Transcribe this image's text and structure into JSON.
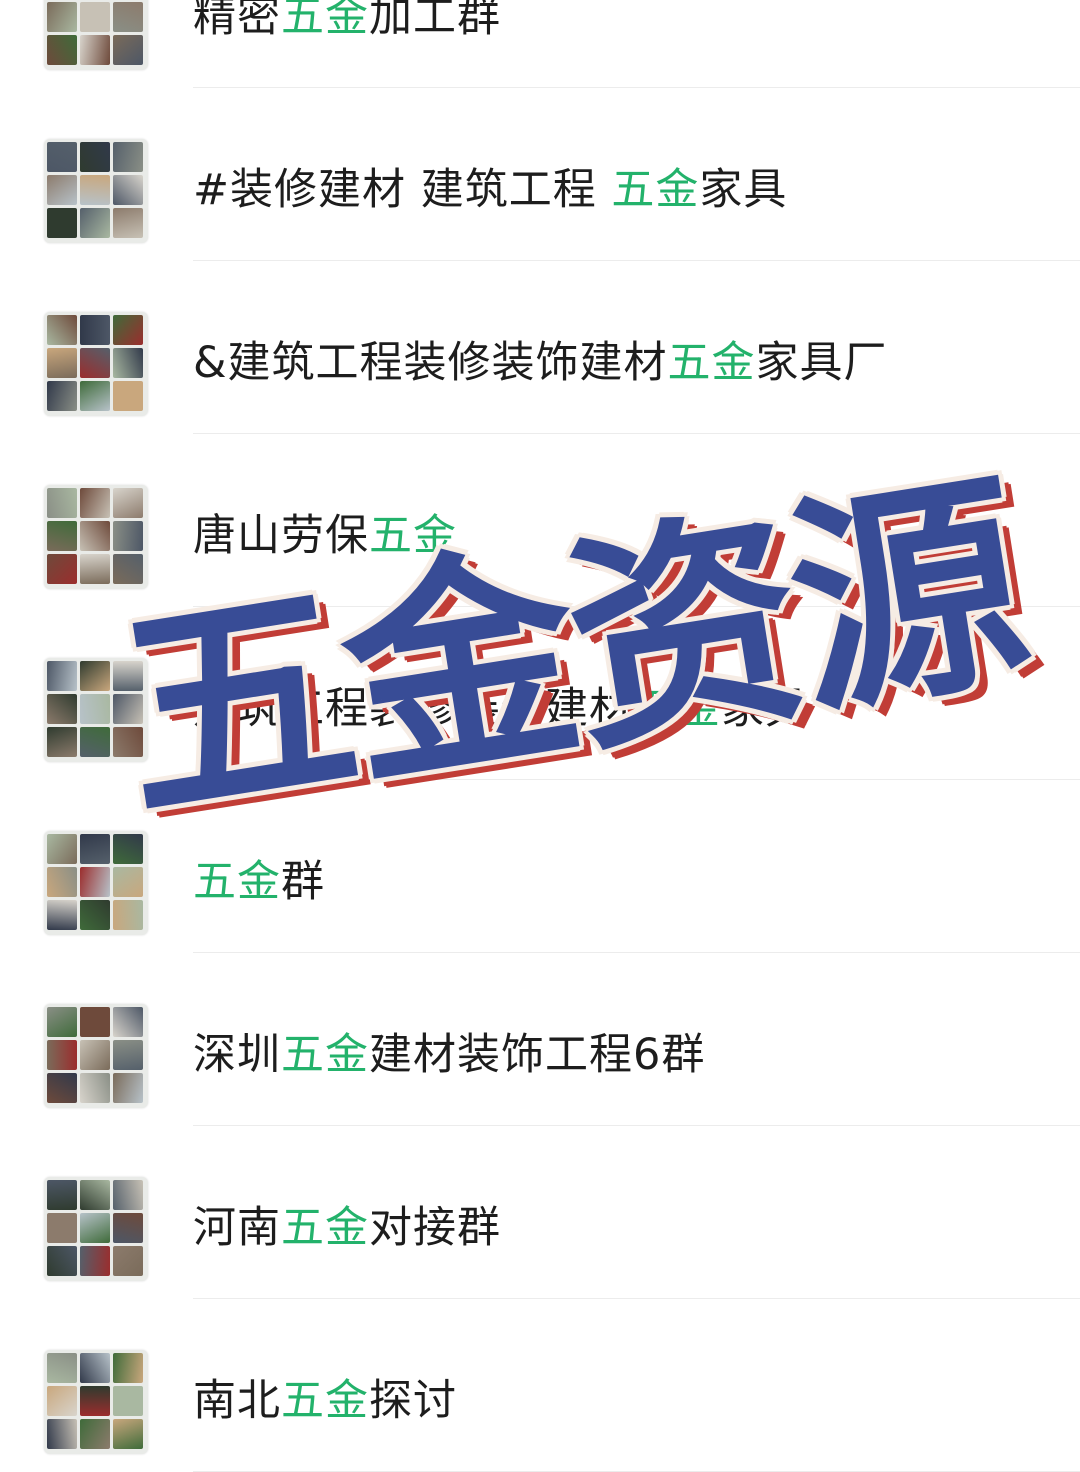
{
  "groups": [
    {
      "name_before": "精密",
      "highlight": "五金",
      "name_after": "加工群"
    },
    {
      "name_before": "#装修建材 建筑工程 ",
      "highlight": "五金",
      "name_after": "家具"
    },
    {
      "name_before": "&建筑工程装修装饰建材",
      "highlight": "五金",
      "name_after": "家具厂"
    },
    {
      "name_before": "唐山劳保",
      "highlight": "五金",
      "name_after": ""
    },
    {
      "name_before": "建筑工程装修装饰建材",
      "highlight": "五金",
      "name_after": "家具"
    },
    {
      "name_before": "",
      "highlight": "五金",
      "name_after": "群"
    },
    {
      "name_before": "深圳",
      "highlight": "五金",
      "name_after": "建材装饰工程6群"
    },
    {
      "name_before": "河南",
      "highlight": "五金",
      "name_after": "对接群"
    },
    {
      "name_before": "南北",
      "highlight": "五金",
      "name_after": "探讨"
    }
  ],
  "overlay": {
    "text": "五金资源"
  },
  "colors": {
    "highlight": "#23b26b",
    "overlay_fill": "#384c96",
    "overlay_shadow": "#c13d36",
    "overlay_outline": "#f6ece4"
  }
}
